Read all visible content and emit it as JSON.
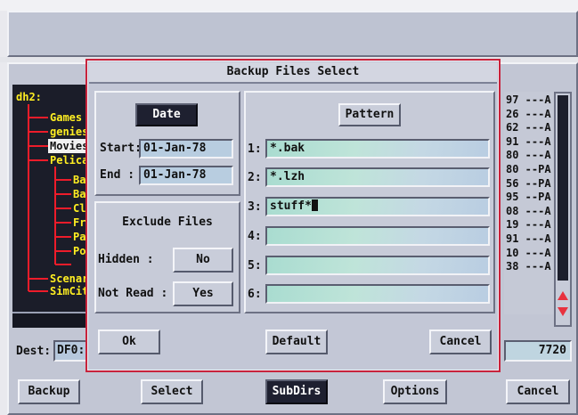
{
  "dialog": {
    "title": "Backup Files Select",
    "date_button": "Date",
    "start_label": "Start:",
    "start_value": "01-Jan-78",
    "end_label": "End   :",
    "end_value": "01-Jan-78",
    "exclude_title": "Exclude Files",
    "hidden_label": "Hidden   :",
    "hidden_value": "No",
    "notread_label": "Not Read :",
    "notread_value": "Yes",
    "pattern_button": "Pattern",
    "patterns": [
      {
        "num": "1:",
        "value": "*.bak"
      },
      {
        "num": "2:",
        "value": "*.lzh"
      },
      {
        "num": "3:",
        "value": "stuff*"
      },
      {
        "num": "4:",
        "value": ""
      },
      {
        "num": "5:",
        "value": ""
      },
      {
        "num": "6:",
        "value": ""
      }
    ],
    "ok_button": "Ok",
    "default_button": "Default",
    "cancel_button": "Cancel"
  },
  "tree": {
    "root": "dh2:",
    "items": [
      "Games",
      "geniest",
      "Movies",
      "Pelican",
      "Back",
      "Bann",
      "Clip",
      "Fran",
      "Patt",
      "Post",
      "Scenari",
      "SimCity"
    ]
  },
  "file_list": [
    "97 ---A",
    "26 ---A",
    "62 ---A",
    "91 ---A",
    "80 ---A",
    "80 --PA",
    "56 --PA",
    "95 --PA",
    "08 ---A",
    "19 ---A",
    "91 ---A",
    "10 ---A",
    "38 ---A"
  ],
  "dest": {
    "label": "Dest:",
    "value": "DF0:",
    "size": "7720"
  },
  "bottom_bar": {
    "backup": "Backup",
    "select": "Select",
    "subdirs": "SubDirs",
    "options": "Options",
    "cancel": "Cancel"
  },
  "colors": {
    "tree_line": "#ee1c2a",
    "tree_text": "#ffee22",
    "dialog_border": "#c8233c",
    "field_bg": "#b4e0d5"
  }
}
